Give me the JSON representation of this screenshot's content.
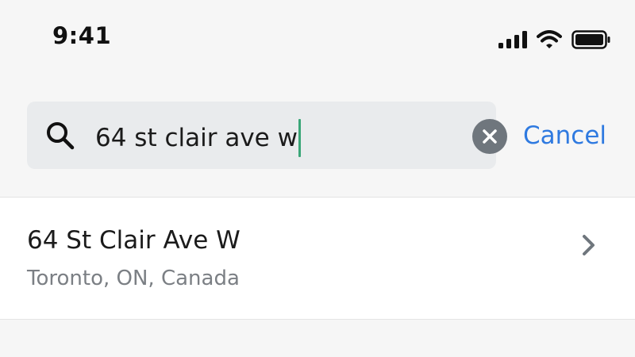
{
  "status_bar": {
    "time": "9:41",
    "icons": [
      "cellular-signal-icon",
      "wifi-icon",
      "battery-icon"
    ]
  },
  "search": {
    "value": "64 st clair ave w",
    "icon": "search-icon",
    "clear_icon": "clear-icon",
    "cancel_label": "Cancel"
  },
  "results": [
    {
      "title": "64 St Clair Ave W",
      "subtitle": "Toronto, ON, Canada",
      "icon": "chevron-right-icon"
    }
  ],
  "colors": {
    "accent": "#2f7ae0",
    "caret": "#3aa678",
    "background": "#f6f6f6",
    "field": "#e9ebed"
  }
}
